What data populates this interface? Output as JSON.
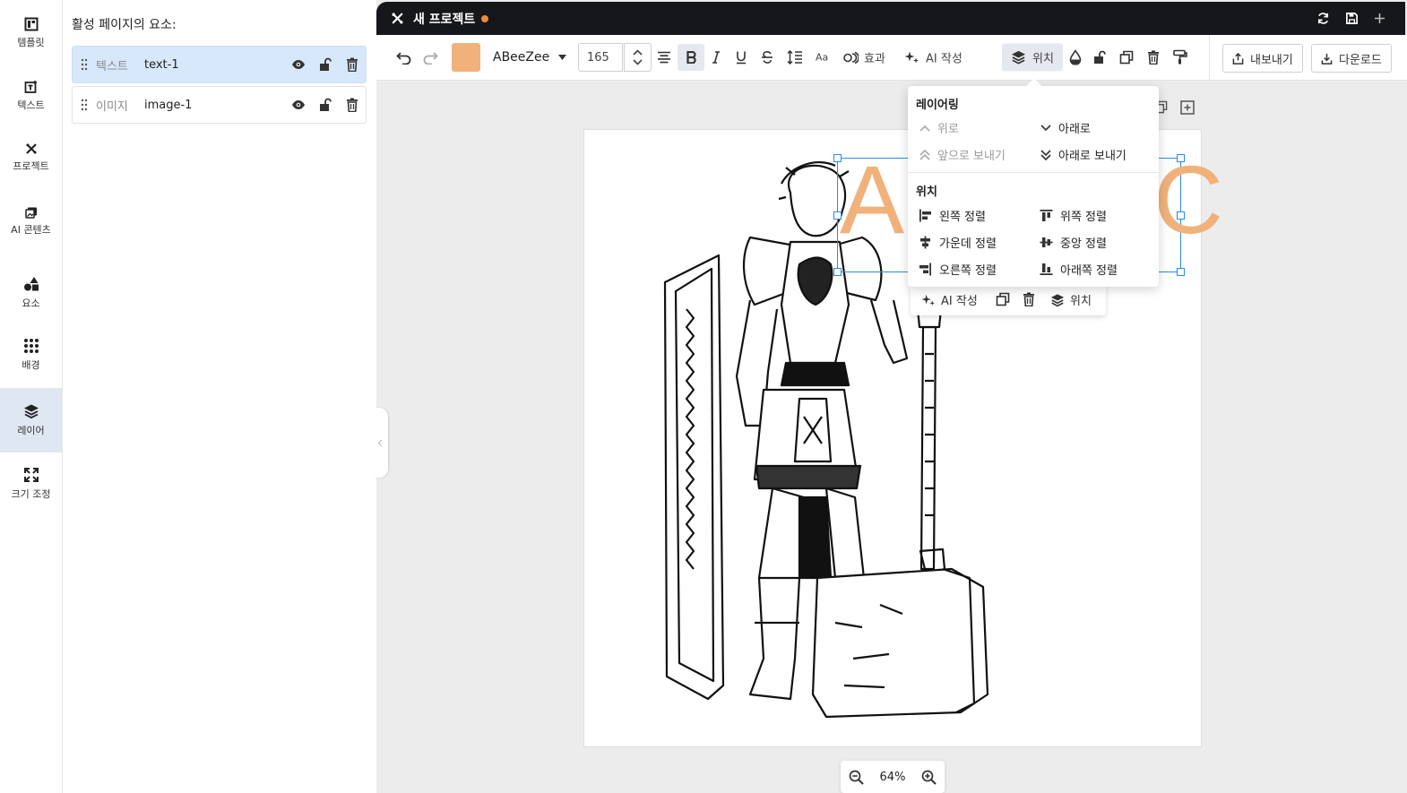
{
  "sidebar": {
    "items": [
      {
        "label": "템플릿",
        "icon": "template-icon"
      },
      {
        "label": "텍스트",
        "icon": "text-icon"
      },
      {
        "label": "프로젝트",
        "icon": "project-icon"
      },
      {
        "label": "AI 콘텐츠",
        "icon": "ai-content-icon"
      },
      {
        "label": "요소",
        "icon": "elements-icon"
      },
      {
        "label": "배경",
        "icon": "background-icon"
      },
      {
        "label": "레이어",
        "icon": "layers-icon",
        "active": true
      },
      {
        "label": "크기 조정",
        "icon": "resize-icon"
      }
    ]
  },
  "layers_panel": {
    "title": "활성 페이지의 요소:",
    "rows": [
      {
        "type": "텍스트",
        "name": "text-1",
        "selected": true
      },
      {
        "type": "이미지",
        "name": "image-1",
        "selected": false
      }
    ]
  },
  "titlebar": {
    "project_name": "새 프로젝트",
    "unsaved_dot_color": "#f08a3c"
  },
  "toolbar": {
    "color_swatch": "#f0b27a",
    "font_family": "ABeeZee",
    "font_size": "165",
    "effects_label": "효과",
    "ai_write_label": "AI 작성",
    "position_label": "위치",
    "export_label": "내보내기",
    "download_label": "다운로드"
  },
  "popover": {
    "layering_title": "레이어링",
    "layering": {
      "up": "위로",
      "down": "아래로",
      "to_front": "앞으로 보내기",
      "to_back": "아래로 보내기"
    },
    "position_title": "위치",
    "position": {
      "align_left": "왼쪽 정렬",
      "align_top": "위쪽 정렬",
      "align_center": "가운데 정렬",
      "align_middle": "중앙 정렬",
      "align_right": "오른쪽 정렬",
      "align_bottom": "아래쪽 정렬"
    }
  },
  "mini_toolbar": {
    "ai_write_label": "AI 작성",
    "position_label": "위치"
  },
  "canvas": {
    "text_content": "A",
    "text_content_right": "C",
    "text_color": "#f0b27a"
  },
  "zoom": {
    "value": "64%"
  }
}
